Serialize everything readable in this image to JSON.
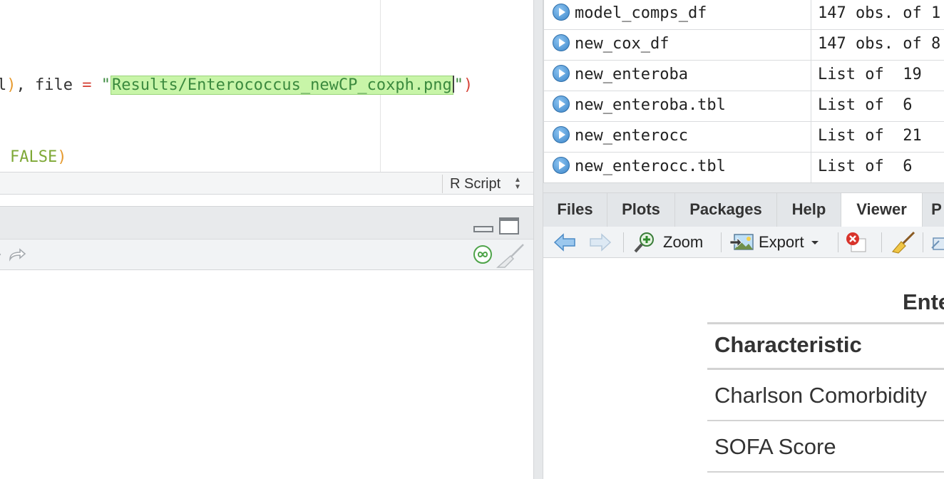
{
  "editor": {
    "line1": {
      "lead": "l",
      "after_paren": ", file ",
      "eq": "=",
      "space": " ",
      "quote_open": "\"",
      "string_value": "Results/Enterococcus_newCP_coxph.png",
      "quote_close": "\""
    },
    "line2": {
      "keyword": "FALSE"
    },
    "status": {
      "file_type": "R Script"
    }
  },
  "environment": {
    "rows": [
      {
        "name": "model_comps_df",
        "value": "147 obs. of 1"
      },
      {
        "name": "new_cox_df",
        "value": "147 obs. of 8"
      },
      {
        "name": "new_enteroba",
        "value": "List of  19"
      },
      {
        "name": "new_enteroba.tbl",
        "value": "List of  6"
      },
      {
        "name": "new_enterocc",
        "value": "List of  21"
      },
      {
        "name": "new_enterocc.tbl",
        "value": "List of  6"
      }
    ]
  },
  "pane": {
    "tabs": [
      {
        "label": "Files"
      },
      {
        "label": "Plots"
      },
      {
        "label": "Packages"
      },
      {
        "label": "Help"
      },
      {
        "label": "Viewer"
      },
      {
        "label": "P"
      }
    ],
    "active_tab": "Viewer",
    "toolbar": {
      "zoom_label": "Zoom",
      "export_label": "Export"
    }
  },
  "viewer": {
    "title": "Ente",
    "column_header": "Characteristic",
    "rows": [
      {
        "label": "Charlson Comorbidity"
      },
      {
        "label": "SOFA Score"
      }
    ]
  },
  "colors": {
    "string": "#3b8a3e",
    "string_highlight": "#c8f5a8",
    "operator": "#d6453a",
    "keyword": "#7ea836",
    "play_icon": "#3c86c9"
  }
}
